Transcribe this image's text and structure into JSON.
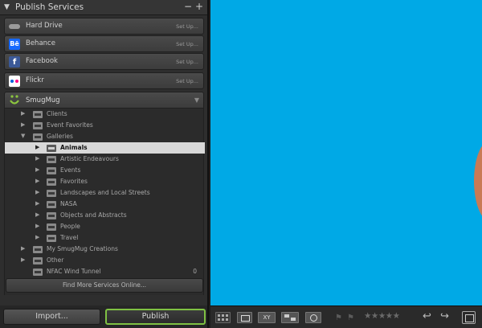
{
  "panel": {
    "title": "Publish Services",
    "minus": "−",
    "plus": "+"
  },
  "services": [
    {
      "label": "Hard Drive",
      "setup": "Set Up...",
      "icon": "hard-drive-icon"
    },
    {
      "label": "Behance",
      "setup": "Set Up...",
      "icon": "behance-icon",
      "glyph": "Bē"
    },
    {
      "label": "Facebook",
      "setup": "Set Up...",
      "icon": "facebook-icon",
      "glyph": "f"
    },
    {
      "label": "Flickr",
      "setup": "Set Up...",
      "icon": "flickr-icon"
    }
  ],
  "smugmug": {
    "label": "SmugMug",
    "icon": "smugmug-icon",
    "tree": [
      {
        "label": "Clients"
      },
      {
        "label": "Event Favorites"
      },
      {
        "label": "Galleries"
      },
      {
        "label": "Animals"
      },
      {
        "label": "Artistic Endeavours"
      },
      {
        "label": "Events"
      },
      {
        "label": "Favorites"
      },
      {
        "label": "Landscapes and Local Streets"
      },
      {
        "label": "NASA"
      },
      {
        "label": "Objects and Abstracts"
      },
      {
        "label": "People"
      },
      {
        "label": "Travel"
      },
      {
        "label": "My SmugMug Creations"
      },
      {
        "label": "Other"
      },
      {
        "label": "NFAC Wind Tunnel",
        "count": "0"
      }
    ],
    "find_more": "Find More Services Online..."
  },
  "buttons": {
    "import": "Import...",
    "publish": "Publish"
  },
  "toolbar": {
    "xy": "XY",
    "stars": "★★★★★",
    "rotate_left": "↩",
    "rotate_right": "↪"
  },
  "colors": {
    "accent": "#7fc143",
    "photo_background": "#00a9e6",
    "selected_row": "#d8d8d8"
  }
}
